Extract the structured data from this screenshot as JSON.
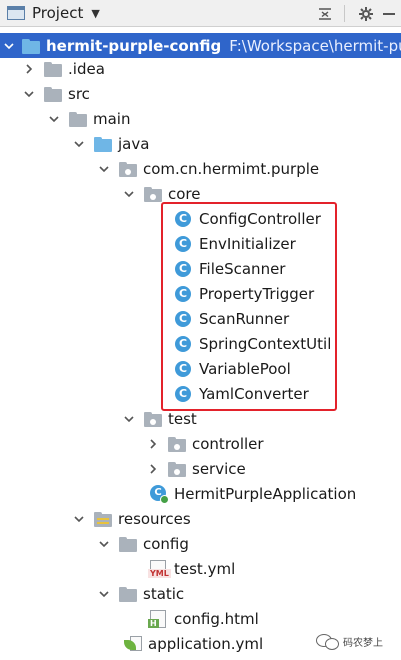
{
  "header": {
    "title": "Project",
    "icons": [
      "project-view-icon",
      "chevron-down-icon",
      "collapse-all-icon",
      "gear-icon",
      "hide-icon"
    ]
  },
  "tree": {
    "root": {
      "label": "hermit-purple-config",
      "path": "F:\\Workspace\\hermit-purple"
    },
    "idea": "idea",
    "idea_prefix": ".",
    "src": "src",
    "main": "main",
    "java": "java",
    "package": "com.cn.hermimt.purple",
    "core": "core",
    "core_classes": [
      "ConfigController",
      "EnvInitializer",
      "FileScanner",
      "PropertyTrigger",
      "ScanRunner",
      "SpringContextUtil",
      "VariablePool",
      "YamlConverter"
    ],
    "test": "test",
    "controller": "controller",
    "service": "service",
    "app_class": "HermitPurpleApplication",
    "resources": "resources",
    "config": "config",
    "test_yml": "test.yml",
    "static": "static",
    "config_html": "config.html",
    "application_yml": "application.yml"
  },
  "badges": {
    "yml": "YML",
    "html": "H",
    "class": "C"
  },
  "colors": {
    "selection": "#2f65ca",
    "highlight_border": "#e3222b",
    "class_icon": "#3f9ad9",
    "source_folder": "#6fb6e6"
  },
  "watermark": {
    "text": "码农梦上"
  }
}
